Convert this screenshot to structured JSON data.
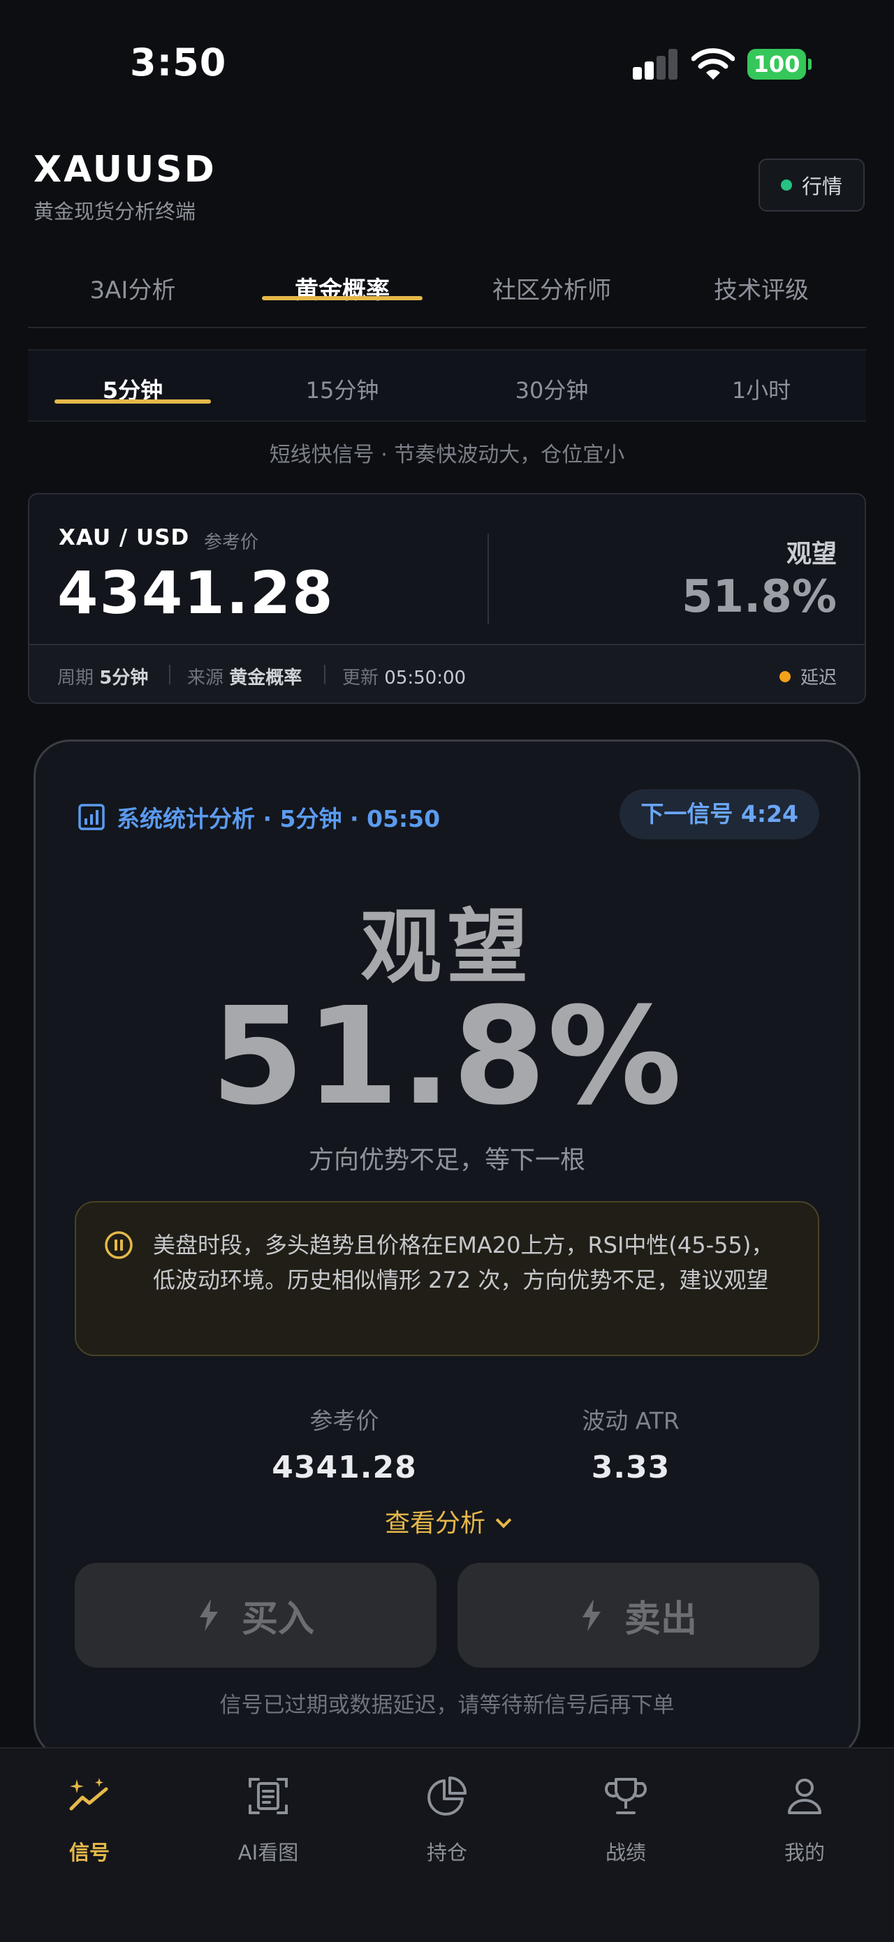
{
  "status_bar": {
    "time": "3:50",
    "battery": "100"
  },
  "header": {
    "symbol": "XAUUSD",
    "subtitle": "黄金现货分析终端",
    "market_button": "行情"
  },
  "main_tabs": [
    {
      "label": "3AI分析"
    },
    {
      "label": "黄金概率",
      "active": true
    },
    {
      "label": "社区分析师"
    },
    {
      "label": "技术评级"
    }
  ],
  "timeframes": [
    {
      "label": "5分钟",
      "active": true
    },
    {
      "label": "15分钟"
    },
    {
      "label": "30分钟"
    },
    {
      "label": "1小时"
    }
  ],
  "timeframe_hint": "短线快信号 · 节奏快波动大，仓位宜小",
  "price_card": {
    "pair": "XAU / USD",
    "ref_label": "参考价",
    "price": "4341.28",
    "signal": "观望",
    "probability": "51.8%",
    "period_label": "周期",
    "period_value": "5分钟",
    "source_label": "来源",
    "source_value": "黄金概率",
    "update_label": "更新",
    "update_value": "05:50:00",
    "delay_label": "延迟"
  },
  "signal_card": {
    "header": "系统统计分析 · 5分钟 · 05:50",
    "next_signal": "下一信号 4:24",
    "signal": "观望",
    "probability": "51.8%",
    "caption": "方向优势不足，等下一根",
    "note": "美盘时段，多头趋势且价格在EMA20上方，RSI中性(45-55)，低波动环境。历史相似情形 272 次，方向优势不足，建议观望",
    "ref_price_label": "参考价",
    "ref_price_value": "4341.28",
    "atr_label": "波动 ATR",
    "atr_value": "3.33",
    "view_analysis": "查看分析",
    "buy_label": "买入",
    "sell_label": "卖出",
    "expired_text": "信号已过期或数据延迟，请等待新信号后再下单"
  },
  "bottom_nav": [
    {
      "label": "信号",
      "icon": "signal-sparkle-icon",
      "active": true
    },
    {
      "label": "AI看图",
      "icon": "scan-document-icon"
    },
    {
      "label": "持仓",
      "icon": "pie-chart-icon"
    },
    {
      "label": "战绩",
      "icon": "trophy-icon"
    },
    {
      "label": "我的",
      "icon": "user-icon"
    }
  ],
  "colors": {
    "accent_gold": "#e6b84a",
    "accent_blue": "#5b9bf0",
    "live_green": "#26c281",
    "delay_orange": "#f3a21a",
    "background": "#0c0e12"
  }
}
